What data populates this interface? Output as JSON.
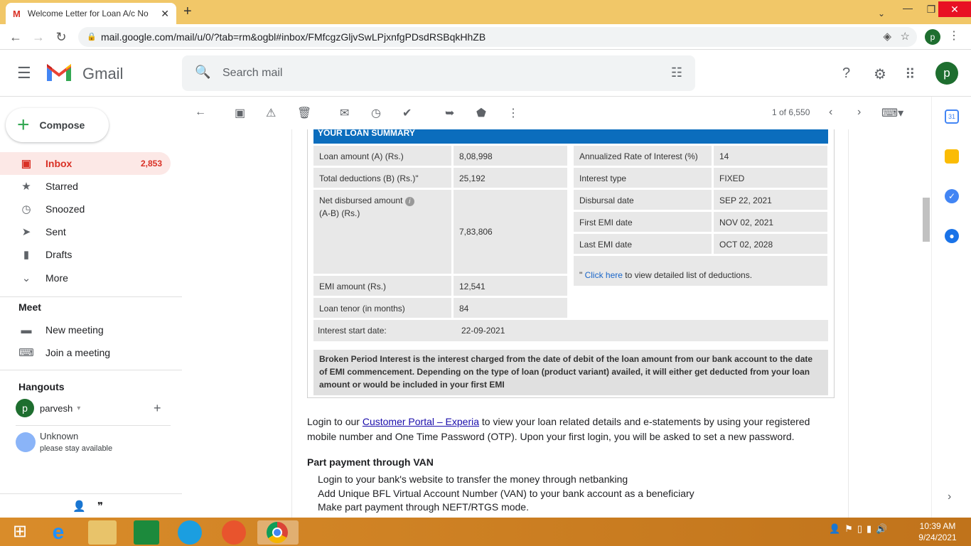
{
  "browser": {
    "tab_title": "Welcome Letter for Loan A/c No",
    "url": "mail.google.com/mail/u/0/?tab=rm&ogbl#inbox/FMfcgzGljvSwLPjxnfgPDsdRSBqkHhZB",
    "profile_initial": "p"
  },
  "gmail": {
    "logo_text": "Gmail",
    "search_placeholder": "Search mail",
    "avatar_initial": "p"
  },
  "sidebar": {
    "compose_label": "Compose",
    "items": [
      {
        "label": "Inbox",
        "count": "2,853",
        "icon": "inbox-icon"
      },
      {
        "label": "Starred",
        "icon": "star-icon"
      },
      {
        "label": "Snoozed",
        "icon": "clock-icon"
      },
      {
        "label": "Sent",
        "icon": "send-icon"
      },
      {
        "label": "Drafts",
        "icon": "draft-icon"
      },
      {
        "label": "More",
        "icon": "chevron-down-icon"
      }
    ],
    "meet": {
      "title": "Meet",
      "new_meeting": "New meeting",
      "join_meeting": "Join a meeting"
    },
    "hangouts": {
      "title": "Hangouts",
      "user": "parvesh",
      "user_initial": "p",
      "contact_name": "Unknown",
      "contact_status": "please stay available"
    }
  },
  "toolbar": {
    "pager": "1 of 6,550"
  },
  "email": {
    "summary_header": "YOUR LOAN SUMMARY",
    "left_rows": [
      {
        "label": "Loan amount (A) (Rs.)",
        "value": "8,08,998"
      },
      {
        "label": "Total deductions (B) (Rs.)\"",
        "value": "25,192"
      },
      {
        "label": "Net disbursed amount",
        "label2": "(A-B) (Rs.)",
        "value": "7,83,806"
      },
      {
        "label": "EMI amount (Rs.)",
        "value": "12,541"
      },
      {
        "label": "Loan tenor (in months)",
        "value": "84"
      }
    ],
    "right_rows": [
      {
        "label": "Annualized Rate of Interest  (%)",
        "value": "14"
      },
      {
        "label": "Interest type",
        "value": "FIXED"
      },
      {
        "label": "Disbursal date",
        "value": "SEP 22, 2021"
      },
      {
        "label": "First EMI date",
        "value": "NOV 02, 2021"
      },
      {
        "label": "Last EMI date",
        "value": "OCT 02, 2028"
      }
    ],
    "click_prefix": "\" ",
    "click_link": "Click here",
    "click_suffix": " to view detailed list of deductions.",
    "interest_start_label": "Interest start date:",
    "interest_start_value": "22-09-2021",
    "bpi_text": "Broken Period Interest is the interest charged from the date of debit of the loan amount from our bank account to the date of EMI commencement. Depending on the type of loan (product variant) availed, it will either get deducted from your loan amount or would be included in your first EMI",
    "login_prefix": "Login to our ",
    "login_link": "Customer Portal – Experia",
    "login_suffix": " to view your loan related details and e-statements by using your registered mobile number and One Time Password (OTP). Upon your first login, you will be asked to set a new password.",
    "van_title": "Part payment through VAN",
    "van_steps": [
      "Login to your bank's website to transfer the money through netbanking",
      "Add Unique BFL Virtual Account Number (VAN) to your bank account as a beneficiary",
      "Make part payment through NEFT/RTGS mode."
    ]
  },
  "taskbar": {
    "time": "10:39 AM",
    "date": "9/24/2021"
  },
  "colors": {
    "accent_red": "#d93025",
    "loan_header_blue": "#0b6dbd",
    "cell_gray": "#e8e8e8"
  }
}
